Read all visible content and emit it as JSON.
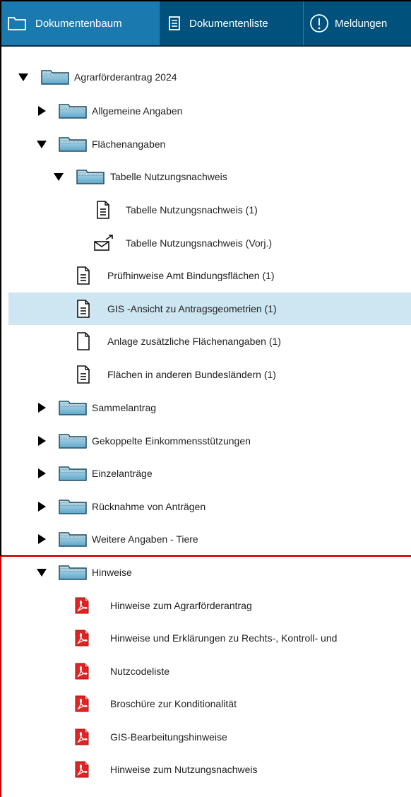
{
  "tabs": [
    {
      "label": "Dokumentenbaum",
      "icon": "folder-outline-icon",
      "active": true
    },
    {
      "label": "Dokumentenliste",
      "icon": "list-document-icon",
      "active": false
    },
    {
      "label": "Meldungen",
      "icon": "exclamation-circle-icon",
      "active": false
    }
  ],
  "tree": {
    "root": "Agrarförderantrag 2024",
    "allgemeine": "Allgemeine Angaben",
    "flaechen": "Flächenangaben",
    "tabelle": "Tabelle Nutzungsnachweis",
    "tabelle_doc": "Tabelle Nutzungsnachweis (1)",
    "tabelle_vorj": "Tabelle Nutzungsnachweis (Vorj.)",
    "pruef": "Prüfhinweise Amt Bindungsflächen (1)",
    "gis": "GIS -Ansicht zu Antragsgeometrien (1)",
    "anlage": "Anlage zusätzliche Flächenangaben (1)",
    "andere": "Flächen in anderen Bundesländern (1)",
    "sammel": "Sammelantrag",
    "gekoppelt": "Gekoppelte Einkommensstützungen",
    "einzel": "Einzelanträge",
    "ruecknahme": "Rücknahme von Anträgen",
    "tiere": "Weitere Angaben - Tiere",
    "hinweise": "Hinweise",
    "h1": "Hinweise zum Agrarförderantrag",
    "h2": "Hinweise und Erklärungen zu Rechts-, Kontroll- und",
    "h3": "Nutzcodeliste",
    "h4": "Broschüre zur Konditionalität",
    "h5": "GIS-Bearbeitungshinweise",
    "h6": "Hinweise zum Nutzungsnachweis"
  },
  "colors": {
    "tabbar": "#00527d",
    "tab_active": "#1a7ab0",
    "selected_row": "#cde6f1",
    "pdf_red": "#d32020"
  }
}
